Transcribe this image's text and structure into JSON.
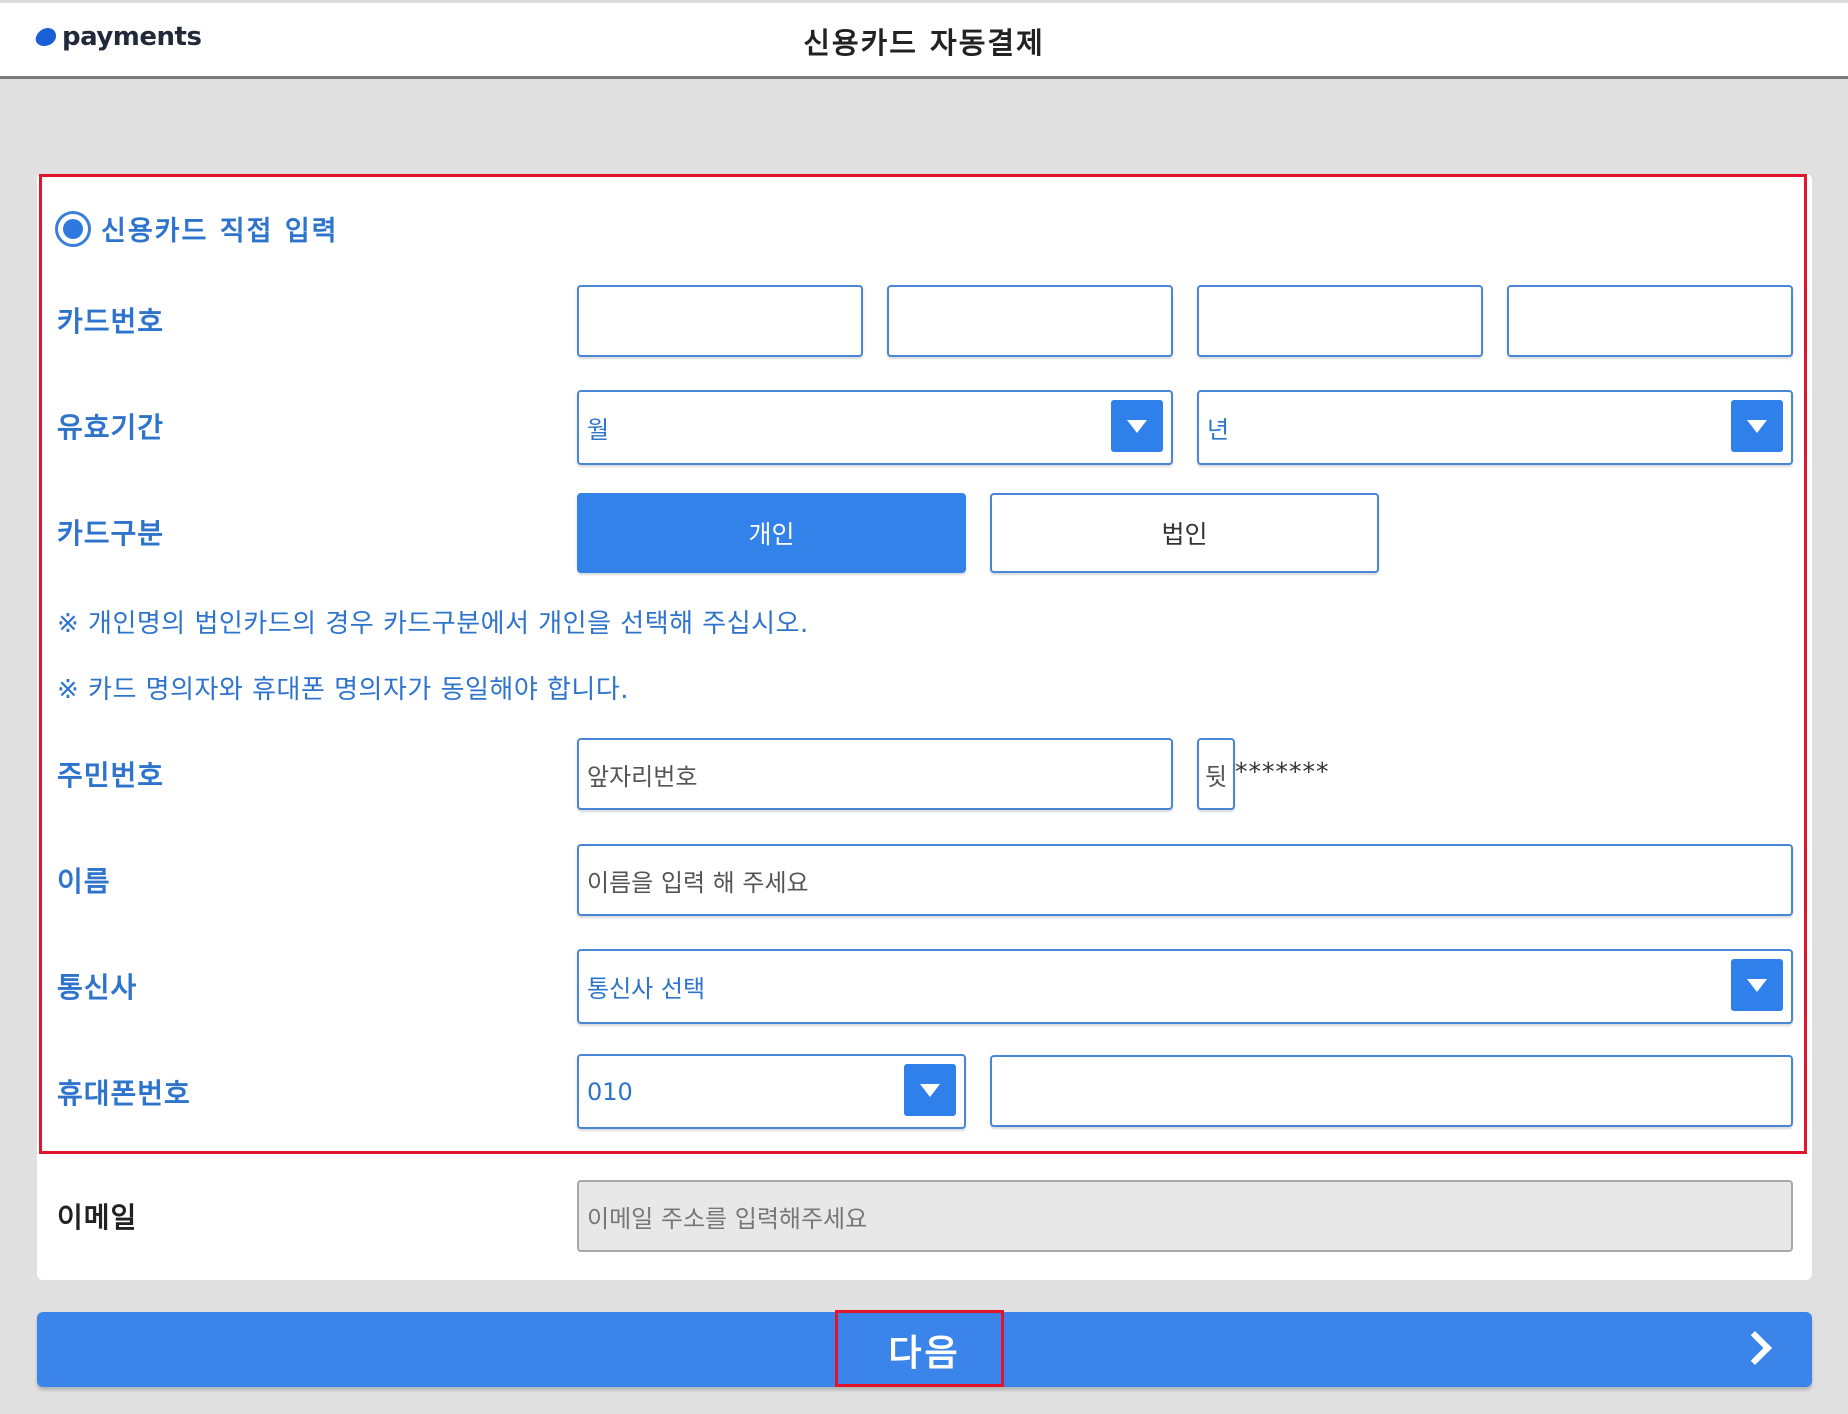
{
  "header": {
    "logo_text": "payments",
    "title": "신용카드 자동결제"
  },
  "form": {
    "radio_label": "신용카드 직접 입력",
    "card_number_label": "카드번호",
    "expiry_label": "유효기간",
    "expiry_month": "월",
    "expiry_year": "년",
    "card_type_label": "카드구분",
    "card_type_personal": "개인",
    "card_type_corporate": "법인",
    "note1": "※ 개인명의 법인카드의 경우 카드구분에서 개인을 선택해 주십시오.",
    "note2": "※ 카드 명의자와 휴대폰 명의자가 동일해야 합니다.",
    "rrn_label": "주민번호",
    "rrn_front_placeholder": "앞자리번호",
    "rrn_back_placeholder": "뒷",
    "rrn_mask": "*******",
    "name_label": "이름",
    "name_placeholder": "이름을 입력 해 주세요",
    "carrier_label": "통신사",
    "carrier_value": "통신사 선택",
    "phone_label": "휴대폰번호",
    "phone_prefix": "010",
    "email_label": "이메일",
    "email_placeholder": "이메일 주소를 입력해주세요"
  },
  "footer": {
    "next_label": "다음"
  },
  "colors": {
    "accent": "#3282ea",
    "label_blue": "#2e74cc",
    "highlight_red": "#e0142b",
    "background": "#e0e0e0"
  }
}
